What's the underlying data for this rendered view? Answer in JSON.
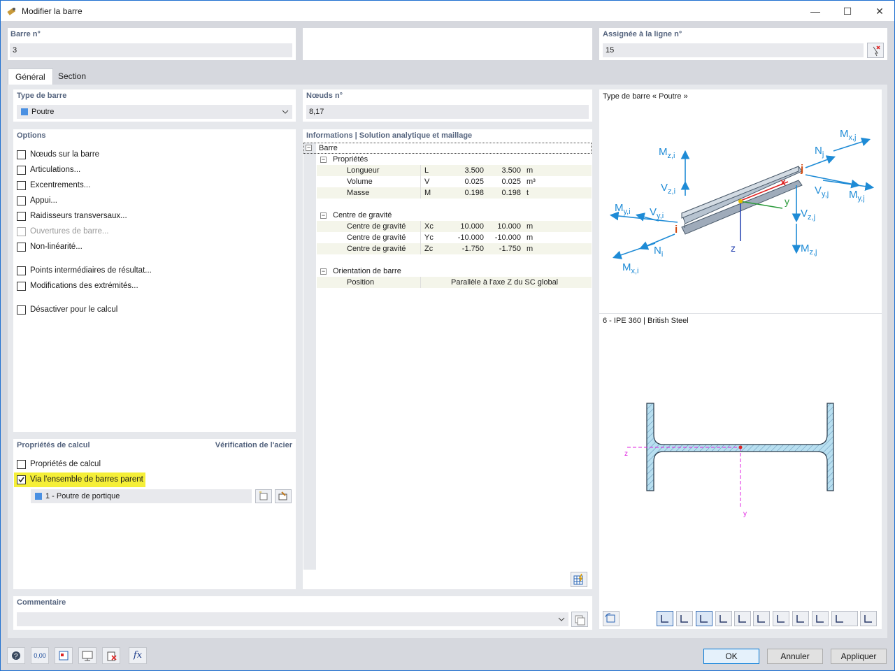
{
  "window": {
    "title": "Modifier la barre"
  },
  "top": {
    "member_no_label": "Barre n°",
    "member_no": "3",
    "line_label": "Assignée à la ligne n°",
    "line_no": "15"
  },
  "tabs": [
    {
      "label": "Général"
    },
    {
      "label": "Section"
    }
  ],
  "member_type": {
    "label": "Type de barre",
    "value": "Poutre"
  },
  "nodes": {
    "label": "Nœuds n°",
    "value": "8,17"
  },
  "options": {
    "label": "Options",
    "items": [
      {
        "label": "Nœuds sur la barre",
        "checked": false,
        "enabled": true
      },
      {
        "label": "Articulations...",
        "checked": false,
        "enabled": true
      },
      {
        "label": "Excentrements...",
        "checked": false,
        "enabled": true
      },
      {
        "label": "Appui...",
        "checked": false,
        "enabled": true
      },
      {
        "label": "Raidisseurs transversaux...",
        "checked": false,
        "enabled": true
      },
      {
        "label": "Ouvertures de barre...",
        "checked": false,
        "enabled": false
      },
      {
        "label": "Non-linéarité...",
        "checked": false,
        "enabled": true
      },
      {
        "label": "Points intermédiaires de résultat...",
        "checked": false,
        "enabled": true
      },
      {
        "label": "Modifications des extrémités...",
        "checked": false,
        "enabled": true
      },
      {
        "label": "Désactiver pour le calcul",
        "checked": false,
        "enabled": true
      }
    ]
  },
  "calc": {
    "label": "Propriétés de calcul",
    "link": "Vérification de l'acier",
    "items": [
      {
        "label": "Propriétés de calcul",
        "checked": false
      },
      {
        "label": "Via l'ensemble de barres parent",
        "checked": true
      }
    ],
    "set": "1 - Poutre de portique"
  },
  "info": {
    "label": "Informations | Solution analytique et maillage",
    "root": "Barre",
    "groups": [
      {
        "label": "Propriétés",
        "rows": [
          {
            "name": "Longueur",
            "sym": "L",
            "v1": "3.500",
            "v2": "3.500",
            "unit": "m"
          },
          {
            "name": "Volume",
            "sym": "V",
            "v1": "0.025",
            "v2": "0.025",
            "unit": "m³"
          },
          {
            "name": "Masse",
            "sym": "M",
            "v1": "0.198",
            "v2": "0.198",
            "unit": "t"
          }
        ]
      },
      {
        "label": "Centre de gravité",
        "rows": [
          {
            "name": "Centre de gravité",
            "sym": "Xc",
            "v1": "10.000",
            "v2": "10.000",
            "unit": "m"
          },
          {
            "name": "Centre de gravité",
            "sym": "Yc",
            "v1": "-10.000",
            "v2": "-10.000",
            "unit": "m"
          },
          {
            "name": "Centre de gravité",
            "sym": "Zc",
            "v1": "-1.750",
            "v2": "-1.750",
            "unit": "m"
          }
        ]
      },
      {
        "label": "Orientation de barre",
        "rows": [
          {
            "name": "Position",
            "value": "Parallèle à l'axe Z du SC global"
          }
        ]
      }
    ]
  },
  "preview": {
    "title": "Type de barre « Poutre »",
    "section_title": "6 - IPE 360 | British Steel"
  },
  "comment": {
    "label": "Commentaire",
    "value": ""
  },
  "footer": {
    "ok": "OK",
    "cancel": "Annuler",
    "apply": "Appliquer",
    "units_label": "0,00"
  }
}
